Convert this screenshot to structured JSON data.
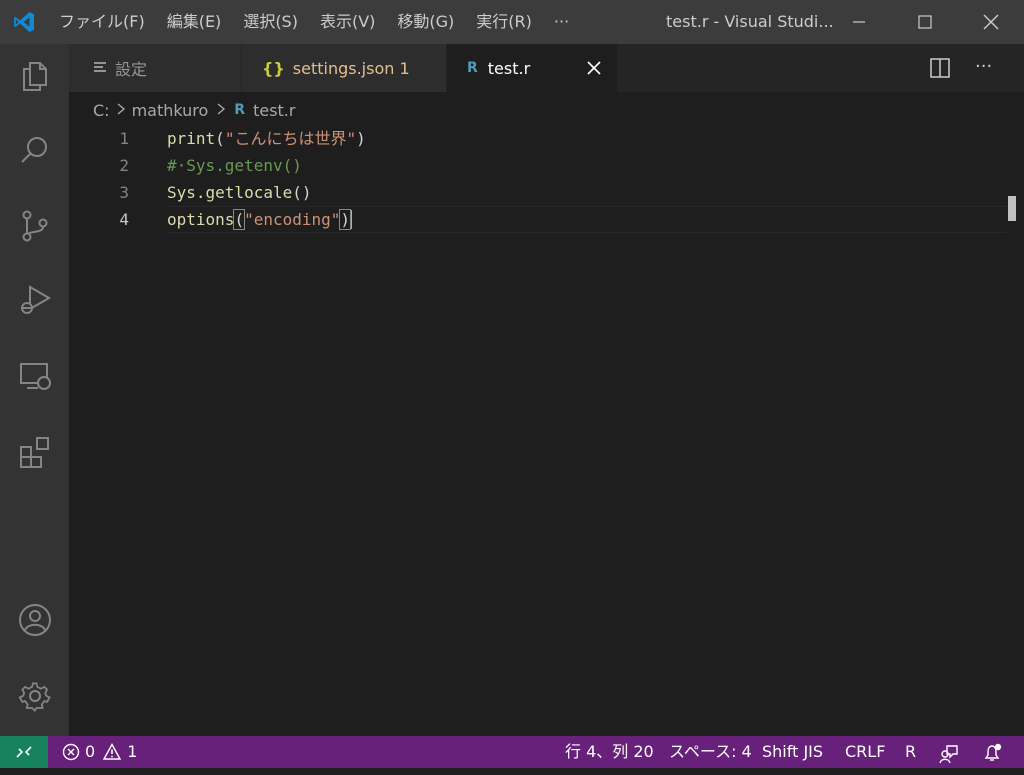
{
  "window": {
    "title": "test.r - Visual Studi...",
    "menu": [
      "ファイル(F)",
      "編集(E)",
      "選択(S)",
      "表示(V)",
      "移動(G)",
      "実行(R)",
      "···"
    ]
  },
  "activity_bar": [
    "explorer-icon",
    "search-icon",
    "source-control-icon",
    "run-debug-icon",
    "remote-explorer-icon",
    "extensions-icon",
    "accounts-icon",
    "manage-gear-icon"
  ],
  "tabs": [
    {
      "label": "設定",
      "icon": "≡"
    },
    {
      "label": "settings.json 1",
      "icon": "{}"
    },
    {
      "label": "test.r",
      "icon": "R"
    }
  ],
  "breadcrumb": [
    "C:",
    "mathkuro",
    "test.r"
  ],
  "editor": {
    "lines": [
      {
        "num": "1",
        "tokens": [
          [
            "fn",
            "print"
          ],
          [
            "punc",
            "("
          ],
          [
            "str",
            "\"こんにちは世界\""
          ],
          [
            "punc",
            ")"
          ]
        ]
      },
      {
        "num": "2",
        "tokens": [
          [
            "cmt",
            "#·Sys.getenv()"
          ]
        ]
      },
      {
        "num": "3",
        "tokens": [
          [
            "fn",
            "Sys.getlocale"
          ],
          [
            "punc",
            "()"
          ]
        ]
      },
      {
        "num": "4",
        "tokens": [
          [
            "fn",
            "options"
          ],
          [
            "punc",
            "("
          ],
          [
            "str",
            "\"encoding\""
          ],
          [
            "punc",
            ")"
          ]
        ]
      }
    ],
    "current_line": 4
  },
  "status": {
    "errors": "0",
    "warnings": "1",
    "position": "行 4、列 20",
    "spaces": "スペース: 4",
    "encoding": "Shift JIS",
    "eol": "CRLF",
    "language": "R"
  },
  "colors": {
    "statusbar": "#68217a",
    "remote": "#16825d",
    "json_tab": "#e2c08d",
    "r_icon": "#519aba"
  }
}
